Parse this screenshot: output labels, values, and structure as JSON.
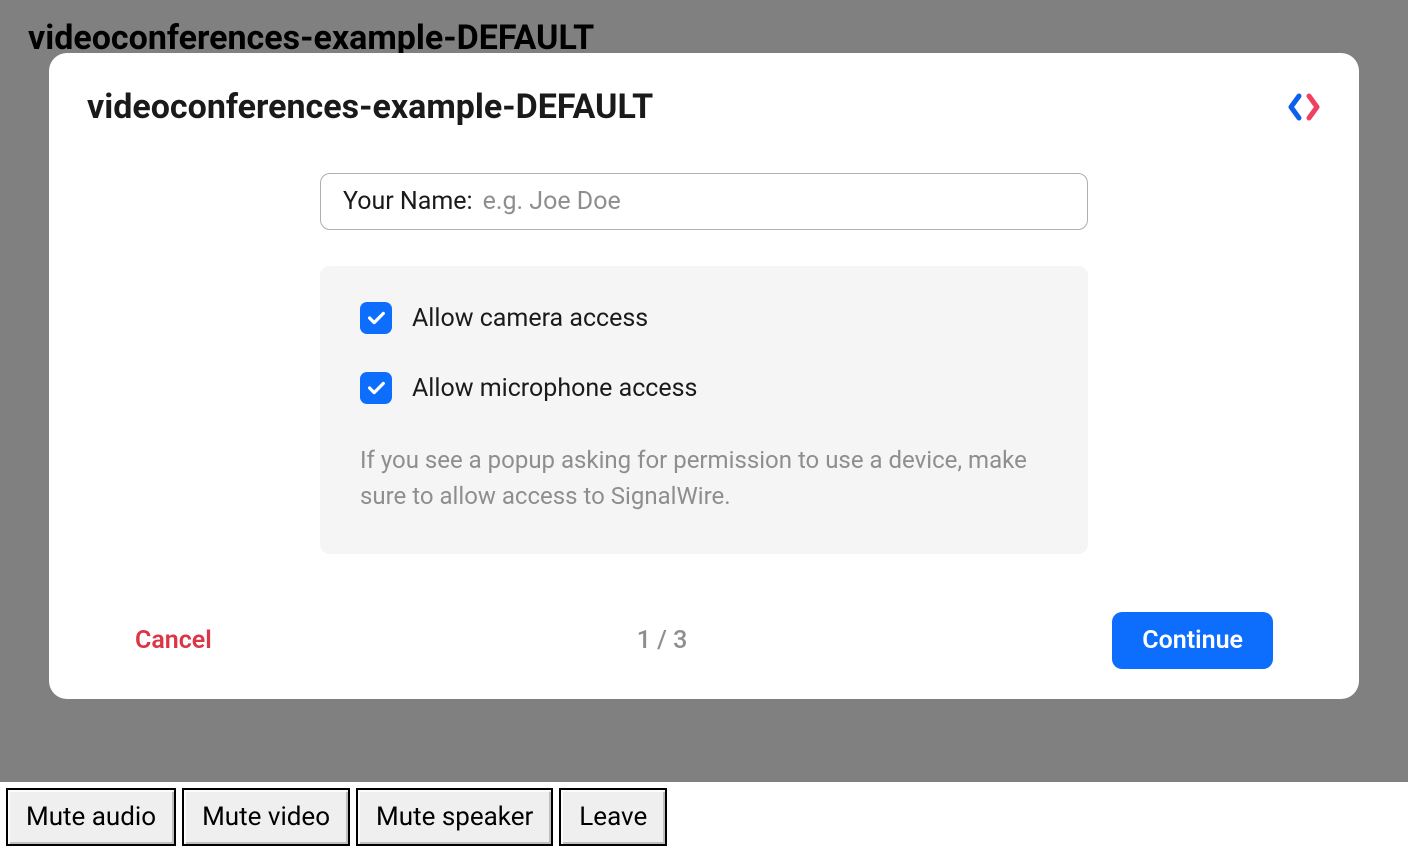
{
  "background": {
    "title": "videoconferences-example-DEFAULT"
  },
  "modal": {
    "title": "videoconferences-example-DEFAULT",
    "name_label": "Your Name:",
    "name_placeholder": "e.g. Joe Doe",
    "name_value": "",
    "permissions": {
      "camera_label": "Allow camera access",
      "camera_checked": true,
      "microphone_label": "Allow microphone access",
      "microphone_checked": true,
      "hint": "If you see a popup asking for permission to use a device, make sure to allow access to SignalWire."
    },
    "cancel_label": "Cancel",
    "step_indicator": "1 / 3",
    "continue_label": "Continue"
  },
  "bottom_bar": {
    "mute_audio": "Mute audio",
    "mute_video": "Mute video",
    "mute_speaker": "Mute speaker",
    "leave": "Leave"
  }
}
